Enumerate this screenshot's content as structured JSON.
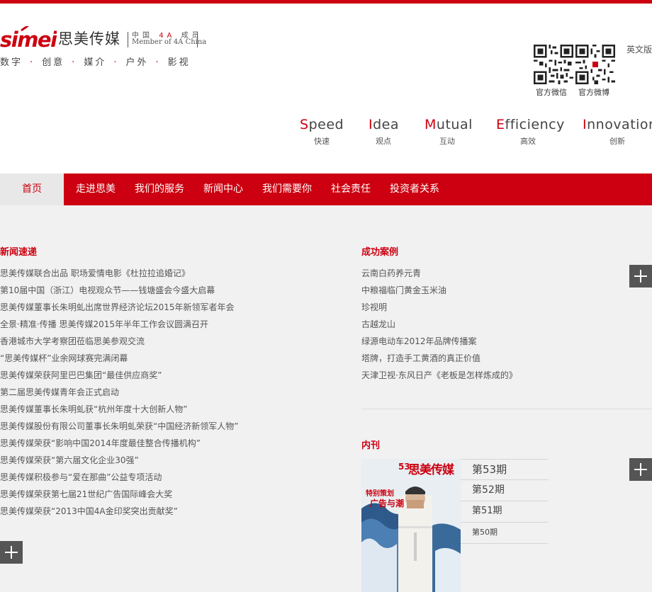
{
  "header": {
    "logo_brand": "simei",
    "logo_cn": "思美传媒",
    "logo_4a_prefix": "中国",
    "logo_4a_mid": "4A",
    "logo_4a_suffix": "成员",
    "logo_en": "Member of 4A China",
    "slogan": [
      "数字",
      "创意",
      "媒介",
      "户外",
      "影视"
    ],
    "qr_wechat_label": "官方微信",
    "qr_weibo_label": "官方微博",
    "language_link": "英文版"
  },
  "values": [
    {
      "cap": "S",
      "rest": "peed",
      "cn": "快速"
    },
    {
      "cap": "I",
      "rest": "dea",
      "cn": "观点"
    },
    {
      "cap": "M",
      "rest": "utual",
      "cn": "互动"
    },
    {
      "cap": "E",
      "rest": "fficiency",
      "cn": "高效"
    },
    {
      "cap": "I",
      "rest": "nnovation",
      "cn": "创新"
    }
  ],
  "nav": {
    "home": "首页",
    "items": [
      "走进思美",
      "我们的服务",
      "新闻中心",
      "我们需要你",
      "社会责任",
      "投资者关系"
    ]
  },
  "news": {
    "title": "新闻速递",
    "items": [
      "思美传媒联合出品 职场爱情电影《杜拉拉追婚记》",
      "第10届中国（浙江）电视观众节——钱塘盛会今盛大启幕",
      "思美传媒董事长朱明虬出席世界经济论坛2015年新领军者年会",
      "全景·精准·传播 思美传媒2015年半年工作会议圆满召开",
      "香港城市大学考察团莅临思美参观交流",
      "“思美传媒杯”业余网球赛完满闭幕",
      "思美传媒荣获阿里巴巴集团“最佳供应商奖”",
      "第二届思美传媒青年会正式启动",
      "思美传媒董事长朱明虬获“杭州年度十大创新人物”",
      "思美传媒股份有限公司董事长朱明虬荣获“中国经济新领军人物”",
      "思美传媒荣获“影响中国2014年度最佳整合传播机构”",
      "思美传媒荣获“第六届文化企业30强”",
      "思美传媒积极参与“爱在那曲”公益专项活动",
      "思美传媒荣获第七届21世纪广告国际峰会大奖",
      "思美传媒荣获“2013中国4A金印奖突出贡献奖”"
    ]
  },
  "cases": {
    "title": "成功案例",
    "items": [
      "云南白药养元青",
      "中粮福临门黄金玉米油",
      "珍视明",
      "古越龙山",
      "绿源电动车2012年品牌传播案",
      "塔牌，打造手工黄酒的真正价值",
      "天津卫视·东风日产《老板是怎样炼成的》"
    ]
  },
  "journal": {
    "title": "内刊",
    "cover_number": "53",
    "cover_title": "思美传媒",
    "cover_tag": "特别策划",
    "cover_headline": "广告与潮",
    "issues": [
      "第53期",
      "第52期",
      "第51期",
      "第50期"
    ]
  },
  "colors": {
    "brand_red": "#cc0010",
    "plus_button": "#555555"
  }
}
